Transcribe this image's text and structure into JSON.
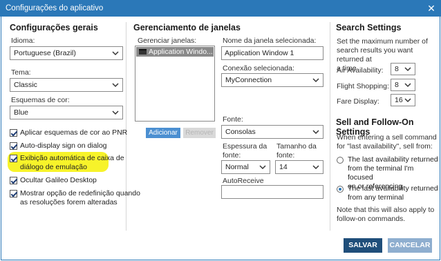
{
  "window": {
    "title": "Configurações do aplicativo",
    "close_glyph": "✕",
    "colors": {
      "accent": "#2b78b8",
      "highlight": "#f7f32a",
      "primary_button": "#1f4e7a",
      "cancel_button": "#8eaecf"
    }
  },
  "general": {
    "title": "Configurações gerais",
    "language_label": "Idioma:",
    "language_value": "Portuguese (Brazil)",
    "theme_label": "Tema:",
    "theme_value": "Classic",
    "color_scheme_label": "Esquemas de cor:",
    "color_scheme_value": "Blue",
    "checkboxes": [
      {
        "label": "Aplicar esquemas de cor ao PNR",
        "checked": true
      },
      {
        "label": "Auto-display sign on dialog",
        "checked": true
      },
      {
        "label": "Exibição automática de caixa de",
        "label2": "diálogo de emulação",
        "checked": true,
        "highlighted": true
      },
      {
        "label": "Ocultar Galileo Desktop",
        "checked": true
      },
      {
        "label": "Mostrar opção de redefinição quando",
        "label2": "as resoluções forem alteradas",
        "checked": true
      }
    ]
  },
  "windows": {
    "title": "Gerenciamento de janelas",
    "manage_label": "Gerenciar janelas:",
    "list_items": [
      "Application Windo..."
    ],
    "add_button": "Adicionar",
    "remove_button": "Remover",
    "selected_name_label": "Nome da janela selecionada:",
    "selected_name_value": "Application Window 1",
    "connection_label": "Conexão selecionada:",
    "connection_value": "MyConnection",
    "font_label": "Fonte:",
    "font_value": "Consolas",
    "thickness_label_1": "Espessura da",
    "thickness_label_2": "fonte:",
    "thickness_value": "Normal",
    "size_label_1": "Tamanho da",
    "size_label_2": "fonte:",
    "size_value": "14",
    "autoreceive_label": "AutoReceive",
    "autoreceive_value": ""
  },
  "search": {
    "title": "Search Settings",
    "description": [
      "Set the maximum number of",
      "search results you want returned at",
      "a time"
    ],
    "air_label": "Air Availability:",
    "air_value": "8",
    "flight_label": "Flight Shopping:",
    "flight_value": "8",
    "fare_label": "Fare Display:",
    "fare_value": "16"
  },
  "sell": {
    "title": "Sell and Follow-On Settings",
    "description": [
      "When entering a sell command",
      "for \"last availability\", sell from:"
    ],
    "options": [
      {
        "lines": [
          "The last availability returned",
          "from the terminal I'm focused",
          "on or referencing"
        ],
        "checked": false
      },
      {
        "lines": [
          "The last availability returned",
          "from any terminal"
        ],
        "checked": true
      }
    ],
    "note": [
      "Note that this will also apply to",
      "follow-on commands."
    ]
  },
  "footer": {
    "save_button": "SALVAR",
    "cancel_button": "CANCELAR"
  }
}
